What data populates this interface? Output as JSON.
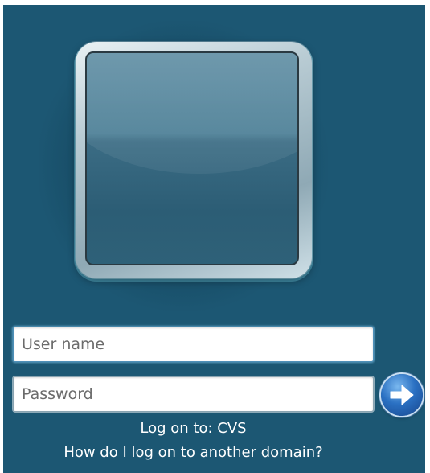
{
  "user_tile": {
    "icon": "user-tile-icon"
  },
  "username": {
    "value": "",
    "placeholder": "User name"
  },
  "password": {
    "value": "",
    "placeholder": "Password"
  },
  "submit": {
    "icon": "arrow-right-icon"
  },
  "logon_to": {
    "label": "Log on to: CVS"
  },
  "other_domain_link": {
    "label": "How do I log on to another domain?"
  },
  "colors": {
    "panel_background": "#1c5773",
    "text": "#ffffff",
    "submit_button": "#2a70c2"
  }
}
